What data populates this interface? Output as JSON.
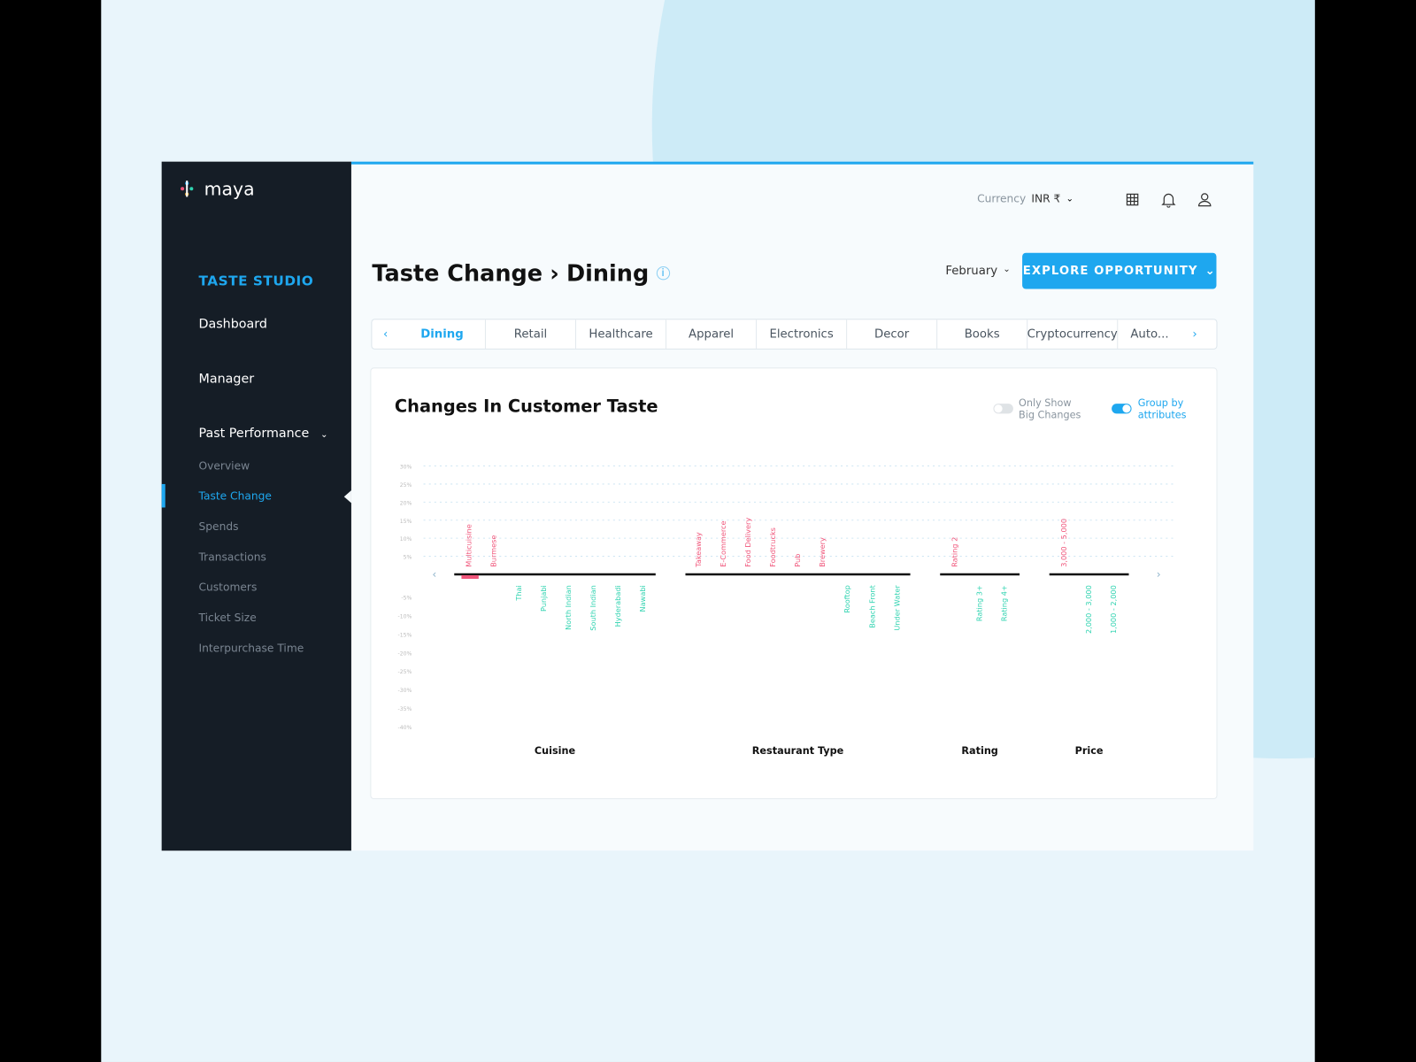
{
  "brand": {
    "name": "maya"
  },
  "sidebar": {
    "section_title": "TASTE STUDIO",
    "items": [
      {
        "label": "Dashboard"
      },
      {
        "label": "Manager"
      },
      {
        "label": "Past Performance"
      }
    ],
    "sub_items": [
      {
        "label": "Overview"
      },
      {
        "label": "Taste Change",
        "active": true
      },
      {
        "label": "Spends"
      },
      {
        "label": "Transactions"
      },
      {
        "label": "Customers"
      },
      {
        "label": "Ticket Size"
      },
      {
        "label": "Interpurchase Time"
      }
    ]
  },
  "header": {
    "currency_label": "Currency",
    "currency_value": "INR ₹",
    "icons": [
      "grid-icon",
      "bell-icon",
      "user-icon"
    ]
  },
  "page": {
    "title": "Taste Change",
    "separator": "›",
    "subtitle": "Dining",
    "month": "February",
    "explore_button": "EXPLORE OPPORTUNITY"
  },
  "tabs": [
    {
      "label": "Dining",
      "active": true
    },
    {
      "label": "Retail"
    },
    {
      "label": "Healthcare"
    },
    {
      "label": "Apparel"
    },
    {
      "label": "Electronics"
    },
    {
      "label": "Decor"
    },
    {
      "label": "Books"
    },
    {
      "label": "Cryptocurrency"
    },
    {
      "label": "Auto..."
    }
  ],
  "card": {
    "title": "Changes In Customer Taste",
    "toggle_big_changes": {
      "label1": "Only Show",
      "label2": "Big Changes",
      "on": false
    },
    "toggle_group": {
      "label1": "Group by",
      "label2": "attributes",
      "on": true
    }
  },
  "colors": {
    "accent": "#1ea7ef",
    "positive": "#f0557a",
    "negative": "#2fd3b0",
    "sidebar": "#151d26"
  },
  "chart_data": {
    "type": "bar",
    "yticks": [
      "30%",
      "25%",
      "20%",
      "15%",
      "10%",
      "5%",
      "-5%",
      "-10%",
      "-15%",
      "-20%",
      "-25%",
      "-30%",
      "-35%",
      "-40%"
    ],
    "grid": true,
    "groups": [
      {
        "name": "Cuisine",
        "items": [
          {
            "label": "Multicuisine",
            "direction": "up",
            "value": -1
          },
          {
            "label": "Burmese",
            "direction": "up"
          },
          {
            "label": "Thai",
            "direction": "down"
          },
          {
            "label": "Punjabi",
            "direction": "down"
          },
          {
            "label": "North Indian",
            "direction": "down"
          },
          {
            "label": "South Indian",
            "direction": "down"
          },
          {
            "label": "Hyderabadi",
            "direction": "down"
          },
          {
            "label": "Nawabi",
            "direction": "down"
          }
        ]
      },
      {
        "name": "Restaurant Type",
        "items": [
          {
            "label": "Takeaway",
            "direction": "up"
          },
          {
            "label": "E-Commerce",
            "direction": "up"
          },
          {
            "label": "Food Delivery",
            "direction": "up"
          },
          {
            "label": "Foodtrucks",
            "direction": "up"
          },
          {
            "label": "Pub",
            "direction": "up"
          },
          {
            "label": "Brewery",
            "direction": "up"
          },
          {
            "label": "Rooftop",
            "direction": "down"
          },
          {
            "label": "Beach Front",
            "direction": "down"
          },
          {
            "label": "Under Water",
            "direction": "down"
          }
        ]
      },
      {
        "name": "Rating",
        "items": [
          {
            "label": "Rating 2",
            "direction": "up"
          },
          {
            "label": "Rating 3+",
            "direction": "down"
          },
          {
            "label": "Rating 4+",
            "direction": "down"
          }
        ]
      },
      {
        "name": "Price",
        "items": [
          {
            "label": "3,000 - 5,000",
            "direction": "up"
          },
          {
            "label": "2,000 - 3,000",
            "direction": "down"
          },
          {
            "label": "1,000 - 2,000",
            "direction": "down"
          }
        ]
      }
    ]
  }
}
